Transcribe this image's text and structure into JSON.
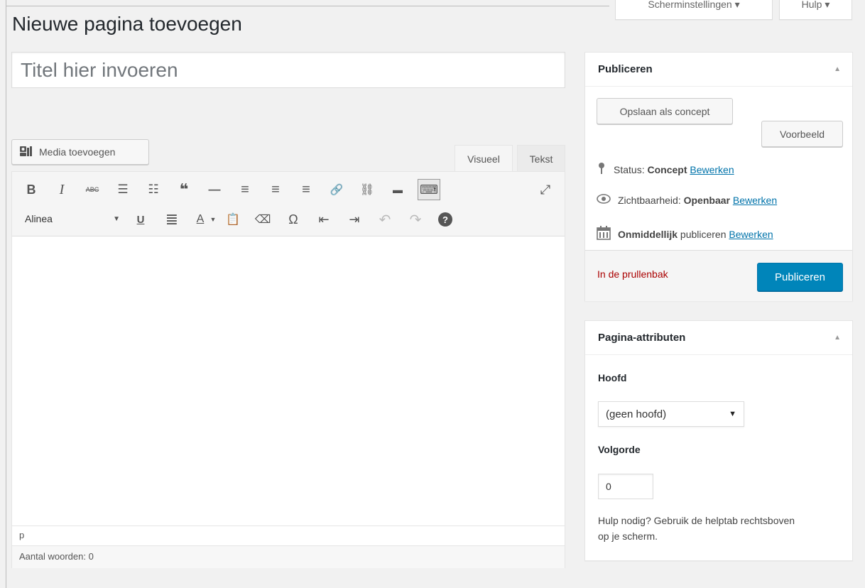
{
  "header": {
    "title": "Nieuwe pagina toevoegen",
    "screen_options_label": "Scherminstellingen ▾",
    "help_label": "Hulp ▾"
  },
  "editor": {
    "title_placeholder": "Titel hier invoeren",
    "media_button_label": "Media toevoegen",
    "tabs": {
      "visual": "Visueel",
      "text": "Tekst"
    },
    "format_select_value": "Alinea",
    "path": "p",
    "word_count_label": "Aantal woorden: 0",
    "toolbar_icons": {
      "bold": "B",
      "italic": "I",
      "strikethrough": "ABC",
      "bullet_list": "☰",
      "numbered_list": "☷",
      "blockquote": "❝",
      "hr": "—",
      "align_left": "≡",
      "align_center": "≡",
      "align_right": "≡",
      "link": "🔗",
      "unlink": "⛓",
      "read_more": "▬",
      "toolbar_toggle": "⌨",
      "fullscreen": "⤢",
      "underline": "U",
      "justify": "≣",
      "text_color": "A",
      "paste_text": "📋",
      "clear_formatting": "⌫",
      "special_char": "Ω",
      "outdent": "⇤",
      "indent": "⇥",
      "undo": "↶",
      "redo": "↷",
      "help": "?"
    }
  },
  "publish": {
    "title": "Publiceren",
    "save_draft_label": "Opslaan als concept",
    "preview_label": "Voorbeeld",
    "status_label": "Status:",
    "status_value": "Concept",
    "visibility_label": "Zichtbaarheid:",
    "visibility_value": "Openbaar",
    "schedule_value": "Onmiddellijk",
    "schedule_label": "publiceren",
    "edit_label": "Bewerken",
    "trash_label": "In de prullenbak",
    "publish_label": "Publiceren"
  },
  "attributes": {
    "title": "Pagina-attributen",
    "parent_label": "Hoofd",
    "parent_value": "(geen hoofd)",
    "order_label": "Volgorde",
    "order_value": "0",
    "help_text": "Hulp nodig? Gebruik de helptab rechtsboven op je scherm."
  },
  "colors": {
    "primary": "#0085ba",
    "link": "#0073aa",
    "trash": "#a00000",
    "background": "#f1f1f1"
  }
}
